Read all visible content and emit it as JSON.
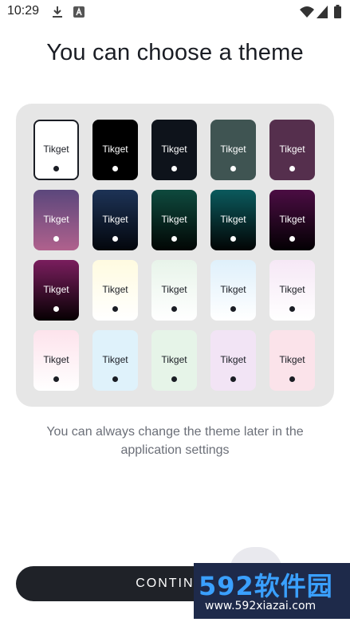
{
  "status_bar": {
    "time": "10:29",
    "left_icons": [
      "download-icon",
      "font-a-icon"
    ],
    "right_icons": [
      "wifi-icon",
      "signal-icon",
      "battery-icon"
    ]
  },
  "title": "You can choose a theme",
  "themes": [
    {
      "label": "Tikget",
      "bg": "#ffffff",
      "text": "#1a1d24",
      "dot": "#1a1d24",
      "selected": true
    },
    {
      "label": "Tikget",
      "bg": "#000000",
      "text": "#ffffff",
      "dot": "#ffffff"
    },
    {
      "label": "Tikget",
      "bg": "#0e131b",
      "text": "#ffffff",
      "dot": "#ffffff"
    },
    {
      "label": "Tikget",
      "bg": "#3f5452",
      "text": "#ffffff",
      "dot": "#ffffff"
    },
    {
      "label": "Tikget",
      "bg": "#552f4d",
      "text": "#ffffff",
      "dot": "#ffffff"
    },
    {
      "label": "Tikget",
      "bg": "linear-gradient(180deg,#5b477c,#b0618d)",
      "text": "#ffffff",
      "dot": "#ffffff"
    },
    {
      "label": "Tikget",
      "bg": "linear-gradient(180deg,#1d3356,#03060c)",
      "text": "#ffffff",
      "dot": "#ffffff"
    },
    {
      "label": "Tikget",
      "bg": "linear-gradient(180deg,#0e4a3e,#020604)",
      "text": "#ffffff",
      "dot": "#ffffff"
    },
    {
      "label": "Tikget",
      "bg": "linear-gradient(180deg,#0b5a5d,#020404)",
      "text": "#ffffff",
      "dot": "#ffffff"
    },
    {
      "label": "Tikget",
      "bg": "linear-gradient(180deg,#4b0d43,#030003)",
      "text": "#ffffff",
      "dot": "#ffffff"
    },
    {
      "label": "Tikget",
      "bg": "linear-gradient(180deg,#7a1e5e,#060002)",
      "text": "#ffffff",
      "dot": "#ffffff"
    },
    {
      "label": "Tikget",
      "bg": "linear-gradient(180deg,#fffbe0,#ffffff)",
      "text": "#1a1d24",
      "dot": "#1a1d24"
    },
    {
      "label": "Tikget",
      "bg": "linear-gradient(180deg,#e8f4ea,#ffffff)",
      "text": "#1a1d24",
      "dot": "#1a1d24"
    },
    {
      "label": "Tikget",
      "bg": "linear-gradient(180deg,#dff0fb,#ffffff)",
      "text": "#1a1d24",
      "dot": "#1a1d24"
    },
    {
      "label": "Tikget",
      "bg": "linear-gradient(180deg,#f6e8f6,#ffffff)",
      "text": "#1a1d24",
      "dot": "#1a1d24"
    },
    {
      "label": "Tikget",
      "bg": "linear-gradient(180deg,#fde3ec,#ffffff)",
      "text": "#1a1d24",
      "dot": "#1a1d24"
    },
    {
      "label": "Tikget",
      "bg": "#dff2fb",
      "text": "#1a1d24",
      "dot": "#1a1d24"
    },
    {
      "label": "Tikget",
      "bg": "#e6f4e8",
      "text": "#1a1d24",
      "dot": "#1a1d24"
    },
    {
      "label": "Tikget",
      "bg": "#f2e4f5",
      "text": "#1a1d24",
      "dot": "#1a1d24"
    },
    {
      "label": "Tikget",
      "bg": "#fbe3ea",
      "text": "#1a1d24",
      "dot": "#1a1d24"
    }
  ],
  "subtitle": "You can always change the theme later in the application settings",
  "continue_button": "CONTINUE",
  "watermark": {
    "logo": "592软件园",
    "url": "www.592xiazai.com"
  }
}
